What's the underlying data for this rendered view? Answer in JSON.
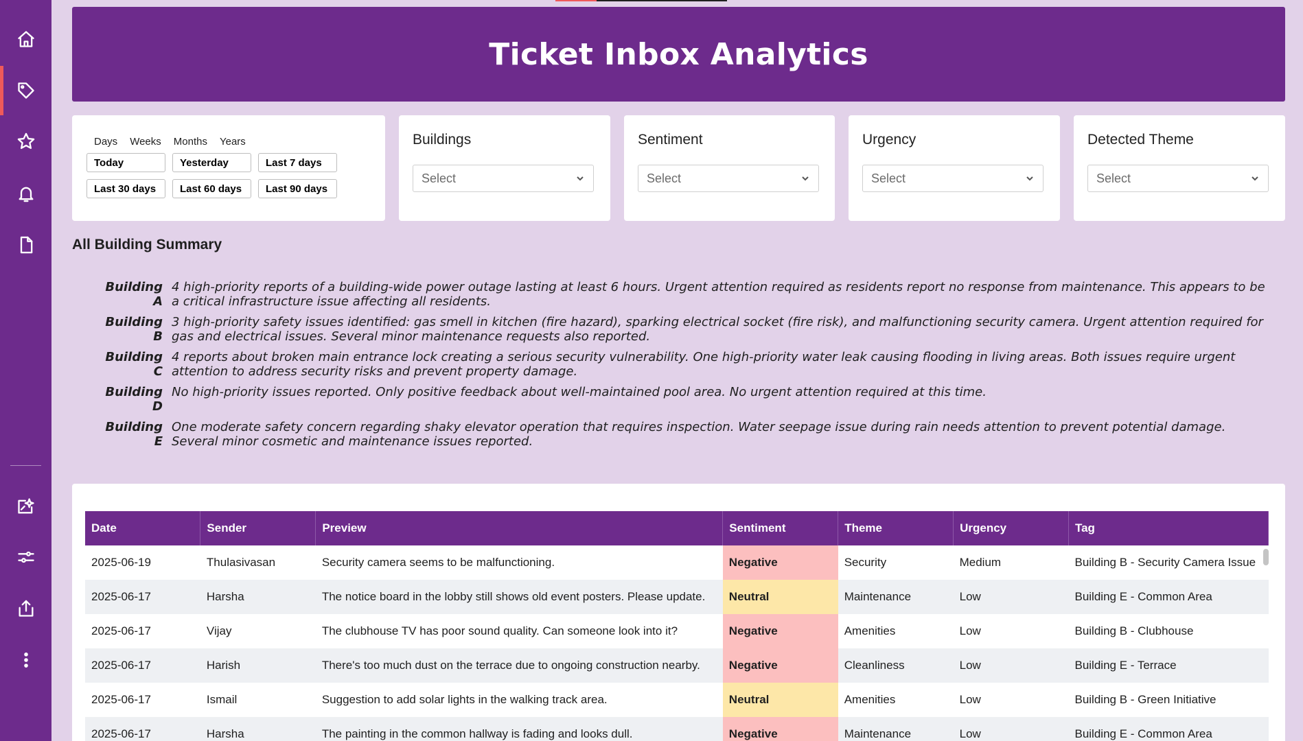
{
  "header": {
    "title": "Ticket Inbox Analytics"
  },
  "sidebar": {
    "items": [
      {
        "name": "home-icon",
        "active": false
      },
      {
        "name": "tag-icon",
        "active": true
      },
      {
        "name": "star-icon",
        "active": false
      },
      {
        "name": "bell-icon",
        "active": false
      },
      {
        "name": "document-icon",
        "active": false
      },
      {
        "name": "sparkle-edit-icon",
        "active": false
      },
      {
        "name": "sliders-icon",
        "active": false
      },
      {
        "name": "export-icon",
        "active": false
      },
      {
        "name": "more-vertical-icon",
        "active": false
      }
    ]
  },
  "date_filter": {
    "tabs": [
      "Days",
      "Weeks",
      "Months",
      "Years"
    ],
    "presets": [
      "Today",
      "Yesterday",
      "Last 7 days",
      "Last 30 days",
      "Last 60 days",
      "Last 90 days"
    ]
  },
  "filters": [
    {
      "label": "Buildings",
      "placeholder": "Select"
    },
    {
      "label": "Sentiment",
      "placeholder": "Select"
    },
    {
      "label": "Urgency",
      "placeholder": "Select"
    },
    {
      "label": "Detected Theme",
      "placeholder": "Select"
    }
  ],
  "summary": {
    "title": "All Building Summary",
    "rows": [
      {
        "building": "Building A",
        "text": "4 high-priority reports of a building-wide power outage lasting at least 6 hours. Urgent attention required as residents report no response from maintenance. This appears to be a critical infrastructure issue affecting all residents."
      },
      {
        "building": "Building B",
        "text": "3 high-priority safety issues identified: gas smell in kitchen (fire hazard), sparking electrical socket (fire risk), and malfunctioning security camera. Urgent attention required for gas and electrical issues. Several minor maintenance requests also reported."
      },
      {
        "building": "Building C",
        "text": "4 reports about broken main entrance lock creating a serious security vulnerability. One high-priority water leak causing flooding in living areas. Both issues require urgent attention to address security risks and prevent property damage."
      },
      {
        "building": "Building D",
        "text": "No high-priority issues reported. Only positive feedback about well-maintained pool area. No urgent attention required at this time."
      },
      {
        "building": "Building E",
        "text": "One moderate safety concern regarding shaky elevator operation that requires inspection. Water seepage issue during rain needs attention to prevent potential damage. Several minor cosmetic and maintenance issues reported."
      }
    ]
  },
  "table": {
    "columns": [
      "Date",
      "Sender",
      "Preview",
      "Sentiment",
      "Theme",
      "Urgency",
      "Tag"
    ],
    "rows": [
      [
        "2025-06-19",
        "Thulasivasan",
        "Security camera seems to be malfunctioning.",
        "Negative",
        "Security",
        "Medium",
        "Building B - Security Camera Issue"
      ],
      [
        "2025-06-17",
        "Harsha",
        "The notice board in the lobby still shows old event posters. Please update.",
        "Neutral",
        "Maintenance",
        "Low",
        "Building E - Common Area"
      ],
      [
        "2025-06-17",
        "Vijay",
        "The clubhouse TV has poor sound quality. Can someone look into it?",
        "Negative",
        "Amenities",
        "Low",
        "Building B - Clubhouse"
      ],
      [
        "2025-06-17",
        "Harish",
        "There's too much dust on the terrace due to ongoing construction nearby.",
        "Negative",
        "Cleanliness",
        "Low",
        "Building E - Terrace"
      ],
      [
        "2025-06-17",
        "Ismail",
        "Suggestion to add solar lights in the walking track area.",
        "Neutral",
        "Amenities",
        "Low",
        "Building B - Green Initiative"
      ],
      [
        "2025-06-17",
        "Harsha",
        "The painting in the common hallway is fading and looks dull.",
        "Negative",
        "Maintenance",
        "Low",
        "Building E - Common Area"
      ]
    ]
  },
  "colors": {
    "primary": "#6d2b8c",
    "background": "#e2d2e9",
    "negative": "#fcbfbf",
    "neutral": "#fde7a8",
    "accent": "#ef5a5a"
  }
}
